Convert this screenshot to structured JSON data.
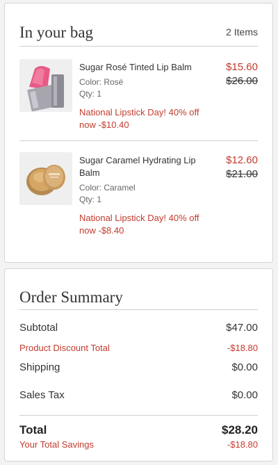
{
  "bag": {
    "title": "In your bag",
    "count": "2 Items",
    "items": [
      {
        "name": "Sugar Rosé Tinted Lip Balm",
        "color": "Color: Rosé",
        "qty": "Qty: 1",
        "promo": "National Lipstick Day! 40% off now -$10.40",
        "price_now": "$15.60",
        "price_was": "$26.00",
        "image_icon": "lipstick-tube"
      },
      {
        "name": "Sugar Caramel Hydrating Lip Balm",
        "color": "Color: Caramel",
        "qty": "Qty: 1",
        "promo": "National Lipstick Day! 40% off now -$8.40",
        "price_now": "$12.60",
        "price_was": "$21.00",
        "image_icon": "lip-balm-pot"
      }
    ]
  },
  "summary": {
    "title": "Order Summary",
    "subtotal_label": "Subtotal",
    "subtotal_value": "$47.00",
    "discount_label": "Product Discount Total",
    "discount_value": "-$18.80",
    "shipping_label": "Shipping",
    "shipping_value": "$0.00",
    "tax_label": "Sales Tax",
    "tax_value": "$0.00",
    "total_label": "Total",
    "total_value": "$28.20",
    "savings_label": "Your Total Savings",
    "savings_value": "-$18.80"
  },
  "colors": {
    "accent_red": "#c23b2e",
    "text": "#333333",
    "border": "#d4d4d4"
  }
}
